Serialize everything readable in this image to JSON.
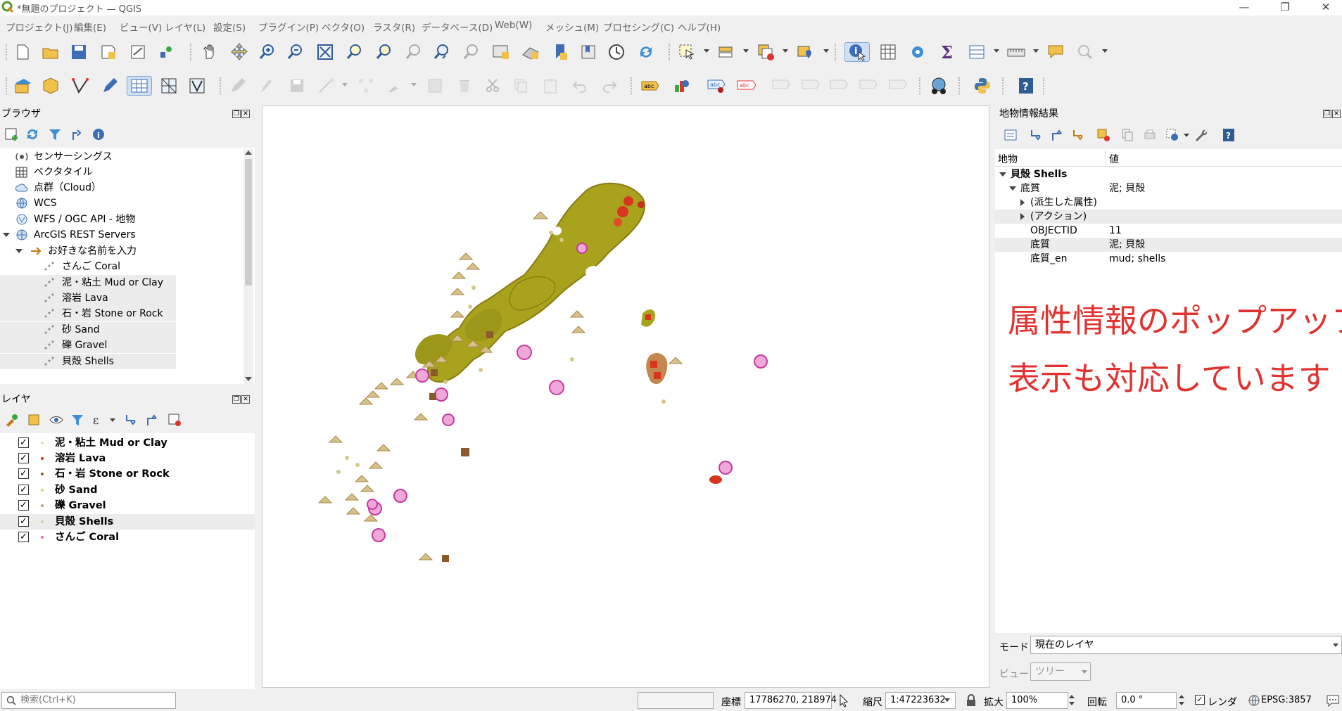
{
  "window": {
    "title": "*無題のプロジェクト — QGIS",
    "minimize": "—",
    "maximize": "❐",
    "close": "✕"
  },
  "menu": [
    "プロジェクト(J)",
    "編集(E)",
    "ビュー(V)",
    "レイヤ(L)",
    "設定(S)",
    "プラグイン(P)",
    "ベクタ(O)",
    "ラスタ(R)",
    "データベース(D)",
    "Web(W)",
    "メッシュ(M)",
    "プロセシング(C)",
    "ヘルプ(H)"
  ],
  "browser": {
    "title": "ブラウザ",
    "items": [
      {
        "label": "センサーシングス"
      },
      {
        "label": "ベクタタイル"
      },
      {
        "label": "点群（Cloud）"
      },
      {
        "label": "WCS"
      },
      {
        "label": "WFS / OGC API - 地物"
      },
      {
        "label": "ArcGIS REST Servers"
      },
      {
        "label": "お好きな名前を入力"
      },
      {
        "label": "さんご Coral"
      },
      {
        "label": "泥・粘土 Mud or Clay"
      },
      {
        "label": "溶岩 Lava"
      },
      {
        "label": "石・岩 Stone or Rock"
      },
      {
        "label": "砂 Sand"
      },
      {
        "label": "礫 Gravel"
      },
      {
        "label": "貝殻 Shells"
      }
    ]
  },
  "layers": {
    "title": "レイヤ",
    "items": [
      {
        "label": "泥・粘土 Mud or Clay",
        "checked": "✓",
        "color": "#e8d8a0"
      },
      {
        "label": "溶岩 Lava",
        "checked": "✓",
        "color": "#d9341e"
      },
      {
        "label": "石・岩 Stone or Rock",
        "checked": "✓",
        "color": "#8a5a2b"
      },
      {
        "label": "砂 Sand",
        "checked": "✓",
        "color": "#e6d27a"
      },
      {
        "label": "礫 Gravel",
        "checked": "✓",
        "color": "#b89a72"
      },
      {
        "label": "貝殻 Shells",
        "checked": "✓",
        "color": "#d8c8a8"
      },
      {
        "label": "さんご Coral",
        "checked": "✓",
        "color": "#e46cb8"
      }
    ]
  },
  "identify": {
    "title": "地物情報結果",
    "col_feature": "地物",
    "col_value": "値",
    "rows": [
      {
        "key": "貝殻 Shells",
        "value": ""
      },
      {
        "key": "底質",
        "value": "泥; 貝殻"
      },
      {
        "key": "(派生した属性)",
        "value": ""
      },
      {
        "key": "(アクション)",
        "value": ""
      },
      {
        "key": "OBJECTID",
        "value": "11"
      },
      {
        "key": "底質",
        "value": "泥; 貝殻"
      },
      {
        "key": "底質_en",
        "value": "mud; shells"
      }
    ],
    "annotation_line1": "属性情報のポップアップ",
    "annotation_line2": "表示も対応しています",
    "mode_label": "モード",
    "mode_value": "現在のレイヤ",
    "view_label": "ビュー",
    "view_value": "ツリー"
  },
  "status": {
    "search_placeholder": "検索(Ctrl+K)",
    "coord_label": "座標",
    "coord_value": "17786270, 218974",
    "scale_label": "縮尺",
    "scale_value": "1:47223632",
    "magnify_label": "拡大",
    "magnify_value": "100%",
    "rotation_label": "回転",
    "rotation_value": "0.0 °",
    "render_label": "レンダ",
    "render_checked": "✓",
    "crs_value": "EPSG:3857"
  },
  "colors": {
    "accent": "#1f6fbf",
    "annotation": "#e0332f",
    "land": "#a8a21c",
    "lava": "#d9341e",
    "coral": "#e46cb8"
  }
}
